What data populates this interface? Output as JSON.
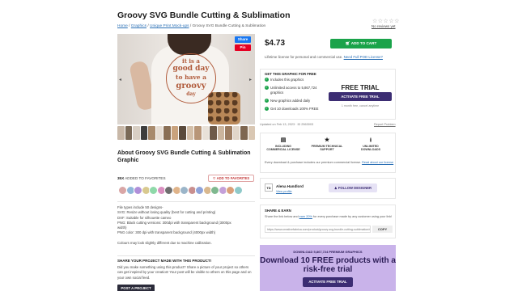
{
  "product": {
    "title": "Groovy SVG Bundle Cutting & Sublimation",
    "stars": "☆☆☆☆☆",
    "reviews": "No reviews yet",
    "image_text": [
      "it is a",
      "good day",
      "to have a",
      "groovy",
      "day"
    ],
    "share_label": "Share",
    "pin_label": "Pin",
    "prev_icon": "chevron-left-icon",
    "next_icon": "chevron-right-icon",
    "thumb_colors": [
      "#c8b8a8",
      "#7a6a58",
      "#d8cfc4",
      "#3d3d3d",
      "#a88a6c",
      "#e6ddd3",
      "#8a6f55",
      "#c9a27c",
      "#5a4a3c",
      "#d4c0aa",
      "#b89678",
      "#e8e1d8",
      "#6e5a48",
      "#cbb59d",
      "#9c7c60",
      "#e1d6c9",
      "#7e6650",
      "#d9c7b3"
    ]
  },
  "breadcrumb": {
    "home": "Home",
    "sep": " / ",
    "graphics": "Graphics",
    "category": "Unique Print Mock-ups",
    "current": "Groovy SVG Bundle Cutting & Sublimation"
  },
  "purchase": {
    "price": "$4.73",
    "add_to_cart": "ADD TO CART",
    "license_text": "Lifetime license for personal and commercial use.",
    "license_link": "Need Full POD License?"
  },
  "free": {
    "heading": "GET THIS GRAPHIC FOR FREE",
    "benefits": [
      "Includes this graphics",
      "Unlimited access to 5,867,724",
      "graphics",
      "New graphics added daily",
      "Get 10 downloads 100% FREE"
    ],
    "trial_heading": "FREE TRIAL",
    "trial_button": "ACTIVATE FREE TRIAL",
    "trial_note": "1 month free, cancel anytime",
    "check_icon": "check-icon"
  },
  "meta": {
    "updated": "Updated on Feb 13, 2023 · ID 2563003",
    "report": "Report Problem"
  },
  "features": {
    "items": [
      {
        "icon": "document-icon",
        "glyph": "▤",
        "label": "INCLUDING COMMERCIAL LICENSE"
      },
      {
        "icon": "star-icon",
        "glyph": "★",
        "label": "PREMIUM TECHNICAL SUPPORT"
      },
      {
        "icon": "download-icon",
        "glyph": "⭳",
        "label": "UNLIMITED DOWNLOADS"
      }
    ],
    "note": "Every download & purchase includes our premium commercial license.",
    "note_link": "Read about our license"
  },
  "about": {
    "heading": "About Groovy SVG Bundle Cutting & Sublimation Graphic",
    "fav_count": "35X",
    "fav_text": "ADDED TO FAVORITES",
    "fav_button": "♡ ADD TO FAVORITES",
    "avatar_colors": [
      "#d9a6a6",
      "#8fb7d9",
      "#b08fd9",
      "#d9c98f",
      "#8fd9a9",
      "#d98fc0",
      "#6f6f6f",
      "#e0b48a",
      "#9bb5c9",
      "#c98f8f",
      "#8fa3d9",
      "#d9b88f",
      "#7fb88f",
      "#c4a0d9",
      "#d99f7a",
      "#8fc9c9"
    ],
    "description": [
      "File types include 50 designs-",
      "SVG: Resize without losing quality (best for cutting and printing)",
      "DXF: Suitable for silhouette cameo",
      "PNG: Black cutting versions: 300dpi with transparent background (3000px",
      "width)",
      "PNG color: 300 dpi with transparent background (4000px width)",
      "",
      "Colours may look slightly different due to machine calibration."
    ]
  },
  "share_made": {
    "heading": "SHARE YOUR PROJECT MADE WITH THIS PRODUCT!",
    "text": "Did you make something using this product? Share a picture of your project so others can get inspired by your creation! Your post will be visible to others on this page and on your own social feed.",
    "button": "POST A PROJECT"
  },
  "designer": {
    "logo": "TD",
    "name": "Alena Handlord",
    "link": "View profile",
    "follow": "♟ FOLLOW DESIGNER"
  },
  "earn": {
    "heading": "SHARE & EARN",
    "text": "Share the link below and",
    "text_link": "earn 20%",
    "text_rest": "for every purchase made by any customer using your link!",
    "link": "https://www.creativefabrica.com/product/groovy-svg-bundle-cutting-sublimation/ref/",
    "copy": "COPY"
  },
  "promo": {
    "small": "DOWNLOAD 5,867,724 PREMIUM GRAPHICS",
    "big_line1": "Download 10 FREE products with a",
    "big_line2": "risk-free trial",
    "button": "ACTIVATE FREE TRIAL"
  },
  "colors": {
    "green": "#1aa34a",
    "purple": "#3c2d73",
    "promo_bg": "#c9b3ea",
    "link": "#2a6fb5"
  }
}
